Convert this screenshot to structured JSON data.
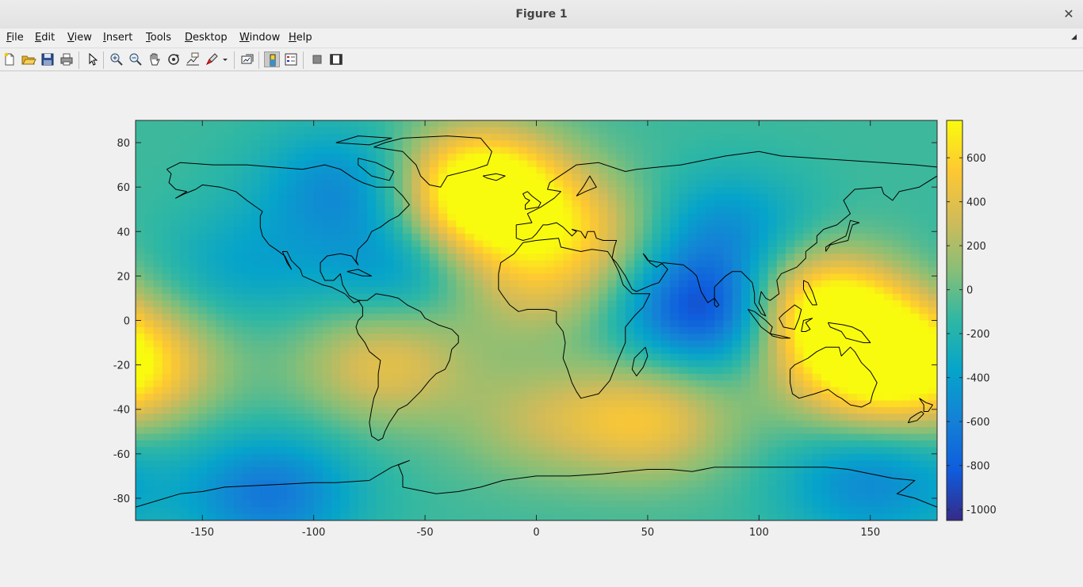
{
  "window": {
    "title": "Figure 1",
    "close_label": "✕"
  },
  "menu": {
    "items": [
      {
        "id": "file",
        "first": "F",
        "rest": "ile"
      },
      {
        "id": "edit",
        "first": "E",
        "rest": "dit"
      },
      {
        "id": "view",
        "first": "V",
        "rest": "iew"
      },
      {
        "id": "insert",
        "first": "I",
        "rest": "nsert"
      },
      {
        "id": "tools",
        "first": "T",
        "rest": "ools"
      },
      {
        "id": "desktop",
        "first": "D",
        "rest": "esktop"
      },
      {
        "id": "window",
        "first": "W",
        "rest": "indow"
      },
      {
        "id": "help",
        "first": "H",
        "rest": "elp"
      }
    ],
    "dock_icon": "dock-arrow-icon"
  },
  "toolbar": {
    "buttons": [
      {
        "name": "new-figure",
        "icon": "new-file-icon"
      },
      {
        "name": "open-file",
        "icon": "folder-open-icon"
      },
      {
        "name": "save-figure",
        "icon": "floppy-disk-icon"
      },
      {
        "name": "print-figure",
        "icon": "printer-icon"
      },
      {
        "name": "edit-plot",
        "icon": "arrow-pointer-icon"
      },
      {
        "name": "zoom-in",
        "icon": "zoom-in-icon"
      },
      {
        "name": "zoom-out",
        "icon": "zoom-out-icon"
      },
      {
        "name": "pan",
        "icon": "hand-icon"
      },
      {
        "name": "rotate-3d",
        "icon": "rotate-3d-icon"
      },
      {
        "name": "data-cursor",
        "icon": "data-cursor-icon"
      },
      {
        "name": "brush",
        "icon": "brush-icon"
      },
      {
        "name": "link-plot",
        "icon": "link-plot-icon"
      },
      {
        "name": "insert-colorbar",
        "icon": "colorbar-icon"
      },
      {
        "name": "insert-legend",
        "icon": "legend-icon"
      },
      {
        "name": "hide-plot-tools",
        "icon": "hide-plot-tools-icon"
      },
      {
        "name": "show-plot-tools",
        "icon": "show-plot-tools-icon"
      }
    ]
  },
  "chart_data": {
    "type": "heatmap",
    "title": "",
    "xlabel": "",
    "ylabel": "",
    "xlim": [
      -180,
      180
    ],
    "ylim": [
      -90,
      90
    ],
    "xticks": [
      -150,
      -100,
      -50,
      0,
      50,
      100,
      150
    ],
    "yticks": [
      80,
      60,
      40,
      20,
      0,
      -20,
      -40,
      -60,
      -80
    ],
    "xtick_labels": [
      "-150",
      "-100",
      "-50",
      "0",
      "50",
      "100",
      "150"
    ],
    "ytick_labels": [
      "80",
      "60",
      "40",
      "20",
      "0",
      "-20",
      "-40",
      "-60",
      "-80"
    ],
    "colormap": "parula",
    "overlay": "world coastlines",
    "colorbar": {
      "range": [
        -1050,
        770
      ],
      "ticks": [
        600,
        400,
        200,
        0,
        -200,
        -400,
        -600,
        -800,
        -1000
      ],
      "tick_labels": [
        "600",
        "400",
        "200",
        "0",
        "-200",
        "-400",
        "-600",
        "-800",
        "-1000"
      ]
    },
    "features": [
      {
        "lon": 80,
        "lat": 5,
        "value": -1000
      },
      {
        "lon": -120,
        "lat": -78,
        "value": -650
      },
      {
        "lon": 150,
        "lat": -72,
        "value": -550
      },
      {
        "lon": -85,
        "lat": 60,
        "value": -550
      },
      {
        "lon": -60,
        "lat": 25,
        "value": -450
      },
      {
        "lon": -130,
        "lat": 25,
        "value": -350
      },
      {
        "lon": 85,
        "lat": 40,
        "value": -500
      },
      {
        "lon": 30,
        "lat": 10,
        "value": -150
      },
      {
        "lon": -25,
        "lat": 50,
        "value": 600
      },
      {
        "lon": -25,
        "lat": 65,
        "value": 550
      },
      {
        "lon": 140,
        "lat": -5,
        "value": 700
      },
      {
        "lon": 120,
        "lat": 10,
        "value": 550
      },
      {
        "lon": 50,
        "lat": -45,
        "value": 450
      },
      {
        "lon": -68,
        "lat": -20,
        "value": 400
      },
      {
        "lon": -180,
        "lat": -20,
        "value": 500
      },
      {
        "lon": 0,
        "lat": 15,
        "value": 300
      },
      {
        "lon": 20,
        "lat": 40,
        "value": 350
      },
      {
        "lon": 150,
        "lat": -30,
        "value": 350
      },
      {
        "lon": 0,
        "lat": -45,
        "value": 200
      }
    ],
    "base_value": -100,
    "colors": {
      "parula": [
        "#352a87",
        "#0f5cdd",
        "#1481d6",
        "#06a4ca",
        "#2eb7a4",
        "#87bf77",
        "#d1bb59",
        "#fec832",
        "#f9fb0e"
      ]
    }
  }
}
